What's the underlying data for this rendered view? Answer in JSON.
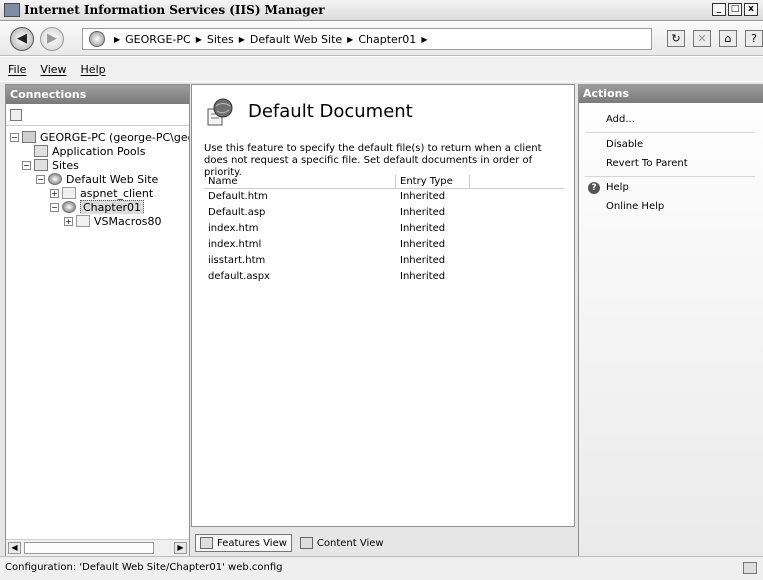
{
  "window": {
    "title": "Internet Information Services (IIS) Manager",
    "minimize": "_",
    "maximize": "□",
    "close": "x"
  },
  "address": {
    "back": "◀",
    "forward": "▶",
    "crumbs": [
      "GEORGE-PC",
      "Sites",
      "Default Web Site",
      "Chapter01"
    ],
    "separator": "▶",
    "toolbar_icons": [
      "refresh-icon",
      "stop-icon",
      "home-icon",
      "help-icon"
    ],
    "help_glyph": "?"
  },
  "menu": {
    "file": "File",
    "view": "View",
    "help": "Help"
  },
  "connections": {
    "header": "Connections",
    "tree": [
      {
        "label": "GEORGE-PC (george-PC\\geo",
        "expander": "−",
        "icon": "server-icon"
      },
      {
        "label": "Application Pools",
        "expander": "",
        "icon": "app-pools-icon"
      },
      {
        "label": "Sites",
        "expander": "−",
        "icon": "sites-icon"
      },
      {
        "label": "Default Web Site",
        "expander": "−",
        "icon": "globe-icon"
      },
      {
        "label": "aspnet_client",
        "expander": "+",
        "icon": "folder-icon"
      },
      {
        "label": "Chapter01",
        "expander": "−",
        "icon": "application-icon"
      },
      {
        "label": "VSMacros80",
        "expander": "+",
        "icon": "folder-icon"
      }
    ],
    "scroll_left": "◀",
    "scroll_right": "▶"
  },
  "content": {
    "title": "Default Document",
    "description": "Use this feature to specify the default file(s) to return when a client does not request a specific file. Set default documents in order of priority.",
    "columns": [
      "Name",
      "Entry Type"
    ],
    "rows": [
      {
        "name": "Default.htm",
        "entry": "Inherited"
      },
      {
        "name": "Default.asp",
        "entry": "Inherited"
      },
      {
        "name": "index.htm",
        "entry": "Inherited"
      },
      {
        "name": "index.html",
        "entry": "Inherited"
      },
      {
        "name": "iisstart.htm",
        "entry": "Inherited"
      },
      {
        "name": "default.aspx",
        "entry": "Inherited"
      }
    ]
  },
  "view_tabs": {
    "features": "Features View",
    "content": "Content View"
  },
  "actions": {
    "header": "Actions",
    "add": "Add...",
    "disable": "Disable",
    "revert": "Revert To Parent",
    "help": "Help",
    "online_help": "Online Help"
  },
  "status": {
    "text": "Configuration: 'Default Web Site/Chapter01' web.config"
  },
  "colors": {
    "pane_header": "#8a8a8a",
    "selection": "#dcdcdc"
  }
}
